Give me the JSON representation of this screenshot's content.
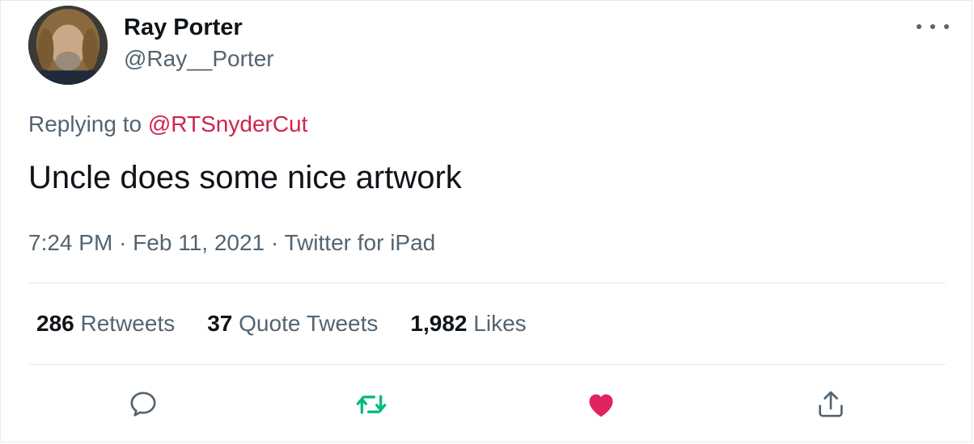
{
  "author": {
    "display_name": "Ray Porter",
    "handle": "@Ray__Porter"
  },
  "more_icon": "more-horizontal-icon",
  "reply_context": {
    "prefix": "Replying to",
    "mention": "@RTSnyderCut"
  },
  "tweet": {
    "text": "Uncle does some nice artwork",
    "time": "7:24 PM",
    "separator": "·",
    "date": "Feb 11, 2021",
    "source": "Twitter for iPad"
  },
  "stats": [
    {
      "count": "286",
      "label": "Retweets"
    },
    {
      "count": "37",
      "label": "Quote Tweets"
    },
    {
      "count": "1,982",
      "label": "Likes"
    }
  ],
  "actions": {
    "reply_icon": "reply-icon",
    "retweet_icon": "retweet-icon",
    "like_icon": "like-heart-icon",
    "share_icon": "share-icon"
  },
  "colors": {
    "text": "#0f1419",
    "secondary": "#536471",
    "mention": "#d0234b",
    "retweet": "#00ba7c",
    "like": "#e0245e",
    "divider": "#e6e9eb"
  }
}
